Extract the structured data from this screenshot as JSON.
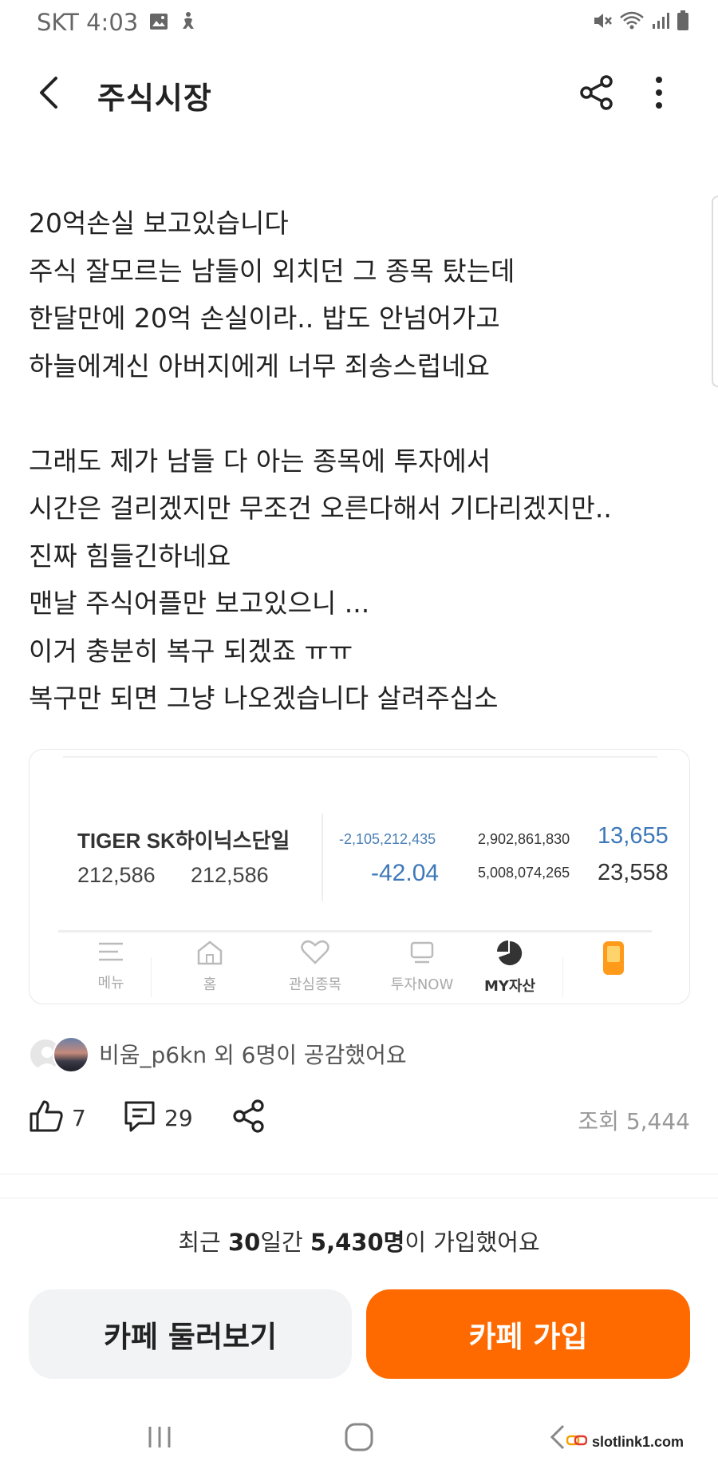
{
  "status_bar": {
    "carrier": "SKT",
    "time": "4:03",
    "icons": [
      "image-icon",
      "accessibility-icon",
      "mute-icon",
      "wifi-icon",
      "signal-icon",
      "battery-icon"
    ]
  },
  "header": {
    "title": "주식시장",
    "icons": [
      "back-arrow-icon",
      "share-icon",
      "more-vertical-icon"
    ]
  },
  "post": {
    "lines": [
      "20억손실 보고있습니다",
      "주식 잘모르는 남들이 외치던 그 종목 탔는데",
      "한달만에 20억 손실이라.. 밥도 안넘어가고",
      "하늘에계신 아버지에게 너무 죄송스럽네요",
      "",
      "그래도 제가 남들 다 아는 종목에 투자에서",
      "시간은 걸리겠지만 무조건 오른다해서 기다리겠지만..",
      "진짜 힘들긴하네요",
      "맨날 주식어플만 보고있으니 ...",
      "이거 충분히 복구 되겠죠 ㅠㅠ",
      "복구만 되면 그냥 나오겠습니다 살려주십소"
    ]
  },
  "embed": {
    "stock_name": "TIGER SK하이닉스단일",
    "qty_1": "212,586",
    "qty_2": "212,586",
    "pnl_amount": "-2,105,212,435",
    "pnl_rate": "-42.04",
    "eval_amount": "2,902,861,830",
    "buy_amount": "5,008,074,265",
    "current_price": "13,655",
    "avg_price": "23,558",
    "colors": {
      "negative_blue": "#3d78b8",
      "accent_orange": "#ff9a1a"
    },
    "nav": [
      {
        "label": "메뉴",
        "icon": "hamburger-menu-icon"
      },
      {
        "label": "홈",
        "icon": "home-icon"
      },
      {
        "label": "관심종목",
        "icon": "heart-icon"
      },
      {
        "label": "투자NOW",
        "icon": "tv-icon"
      },
      {
        "label": "MY자산",
        "icon": "pie-chart-icon",
        "active": true
      },
      {
        "label": "",
        "icon": "phone-app-icon"
      }
    ]
  },
  "likers": {
    "text": "비움_p6kn 외 6명이 공감했어요"
  },
  "actions": {
    "like_count": "7",
    "comment_count": "29",
    "views": "조회 5,444"
  },
  "join": {
    "prefix": "최근 ",
    "days": "30",
    "middle": "일간 ",
    "members": "5,430명",
    "suffix": "이 가입했어요",
    "browse_label": "카페 둘러보기",
    "join_label": "카페 가입",
    "colors": {
      "join_bg": "#ff6a00",
      "browse_bg": "#f2f3f5"
    }
  },
  "watermark": {
    "text": "slotlink1.com"
  }
}
